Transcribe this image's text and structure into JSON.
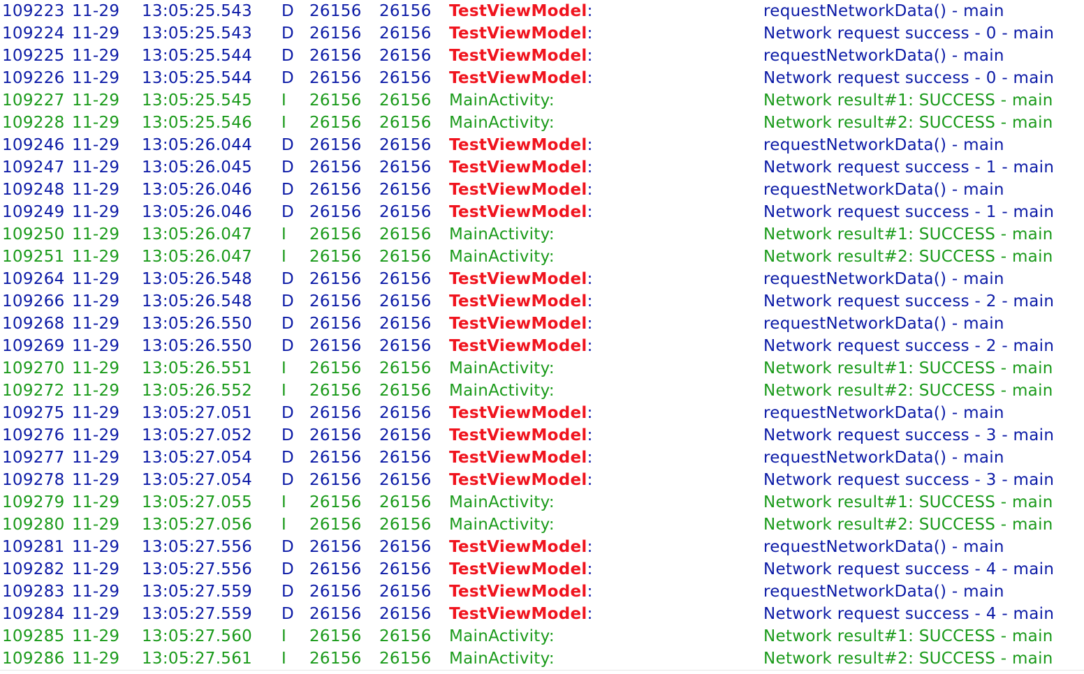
{
  "colors": {
    "debug_text": "#0b1aa6",
    "info_text": "#1a9a1a",
    "highlight_tag": "#f0141e",
    "background": "#ffffff"
  },
  "log_entries": [
    {
      "id": "109223",
      "date": "11-29",
      "time": "13:05:25.543",
      "level": "D",
      "pid": "26156",
      "tid": "26156",
      "tag": "TestViewModel",
      "sep": ":",
      "message": "requestNetworkData() - main"
    },
    {
      "id": "109224",
      "date": "11-29",
      "time": "13:05:25.543",
      "level": "D",
      "pid": "26156",
      "tid": "26156",
      "tag": "TestViewModel",
      "sep": ":",
      "message": "Network request success - 0 - main"
    },
    {
      "id": "109225",
      "date": "11-29",
      "time": "13:05:25.544",
      "level": "D",
      "pid": "26156",
      "tid": "26156",
      "tag": "TestViewModel",
      "sep": ":",
      "message": "requestNetworkData() - main"
    },
    {
      "id": "109226",
      "date": "11-29",
      "time": "13:05:25.544",
      "level": "D",
      "pid": "26156",
      "tid": "26156",
      "tag": "TestViewModel",
      "sep": ":",
      "message": "Network request success - 0 - main"
    },
    {
      "id": "109227",
      "date": "11-29",
      "time": "13:05:25.545",
      "level": "I",
      "pid": "26156",
      "tid": "26156",
      "tag": "MainActivity",
      "sep": ":",
      "message": "Network result#1: SUCCESS - main"
    },
    {
      "id": "109228",
      "date": "11-29",
      "time": "13:05:25.546",
      "level": "I",
      "pid": "26156",
      "tid": "26156",
      "tag": "MainActivity",
      "sep": ":",
      "message": "Network result#2: SUCCESS - main"
    },
    {
      "id": "109246",
      "date": "11-29",
      "time": "13:05:26.044",
      "level": "D",
      "pid": "26156",
      "tid": "26156",
      "tag": "TestViewModel",
      "sep": ":",
      "message": "requestNetworkData() - main"
    },
    {
      "id": "109247",
      "date": "11-29",
      "time": "13:05:26.045",
      "level": "D",
      "pid": "26156",
      "tid": "26156",
      "tag": "TestViewModel",
      "sep": ":",
      "message": "Network request success - 1 - main"
    },
    {
      "id": "109248",
      "date": "11-29",
      "time": "13:05:26.046",
      "level": "D",
      "pid": "26156",
      "tid": "26156",
      "tag": "TestViewModel",
      "sep": ":",
      "message": "requestNetworkData() - main"
    },
    {
      "id": "109249",
      "date": "11-29",
      "time": "13:05:26.046",
      "level": "D",
      "pid": "26156",
      "tid": "26156",
      "tag": "TestViewModel",
      "sep": ":",
      "message": "Network request success - 1 - main"
    },
    {
      "id": "109250",
      "date": "11-29",
      "time": "13:05:26.047",
      "level": "I",
      "pid": "26156",
      "tid": "26156",
      "tag": "MainActivity",
      "sep": ":",
      "message": "Network result#1: SUCCESS - main"
    },
    {
      "id": "109251",
      "date": "11-29",
      "time": "13:05:26.047",
      "level": "I",
      "pid": "26156",
      "tid": "26156",
      "tag": "MainActivity",
      "sep": ":",
      "message": "Network result#2: SUCCESS - main"
    },
    {
      "id": "109264",
      "date": "11-29",
      "time": "13:05:26.548",
      "level": "D",
      "pid": "26156",
      "tid": "26156",
      "tag": "TestViewModel",
      "sep": ":",
      "message": "requestNetworkData() - main"
    },
    {
      "id": "109266",
      "date": "11-29",
      "time": "13:05:26.548",
      "level": "D",
      "pid": "26156",
      "tid": "26156",
      "tag": "TestViewModel",
      "sep": ":",
      "message": "Network request success - 2 - main"
    },
    {
      "id": "109268",
      "date": "11-29",
      "time": "13:05:26.550",
      "level": "D",
      "pid": "26156",
      "tid": "26156",
      "tag": "TestViewModel",
      "sep": ":",
      "message": "requestNetworkData() - main"
    },
    {
      "id": "109269",
      "date": "11-29",
      "time": "13:05:26.550",
      "level": "D",
      "pid": "26156",
      "tid": "26156",
      "tag": "TestViewModel",
      "sep": ":",
      "message": "Network request success - 2 - main"
    },
    {
      "id": "109270",
      "date": "11-29",
      "time": "13:05:26.551",
      "level": "I",
      "pid": "26156",
      "tid": "26156",
      "tag": "MainActivity",
      "sep": ":",
      "message": "Network result#1: SUCCESS - main"
    },
    {
      "id": "109272",
      "date": "11-29",
      "time": "13:05:26.552",
      "level": "I",
      "pid": "26156",
      "tid": "26156",
      "tag": "MainActivity",
      "sep": ":",
      "message": "Network result#2: SUCCESS - main"
    },
    {
      "id": "109275",
      "date": "11-29",
      "time": "13:05:27.051",
      "level": "D",
      "pid": "26156",
      "tid": "26156",
      "tag": "TestViewModel",
      "sep": ":",
      "message": "requestNetworkData() - main"
    },
    {
      "id": "109276",
      "date": "11-29",
      "time": "13:05:27.052",
      "level": "D",
      "pid": "26156",
      "tid": "26156",
      "tag": "TestViewModel",
      "sep": ":",
      "message": "Network request success - 3 - main"
    },
    {
      "id": "109277",
      "date": "11-29",
      "time": "13:05:27.054",
      "level": "D",
      "pid": "26156",
      "tid": "26156",
      "tag": "TestViewModel",
      "sep": ":",
      "message": "requestNetworkData() - main"
    },
    {
      "id": "109278",
      "date": "11-29",
      "time": "13:05:27.054",
      "level": "D",
      "pid": "26156",
      "tid": "26156",
      "tag": "TestViewModel",
      "sep": ":",
      "message": "Network request success - 3 - main"
    },
    {
      "id": "109279",
      "date": "11-29",
      "time": "13:05:27.055",
      "level": "I",
      "pid": "26156",
      "tid": "26156",
      "tag": "MainActivity",
      "sep": ":",
      "message": "Network result#1: SUCCESS - main"
    },
    {
      "id": "109280",
      "date": "11-29",
      "time": "13:05:27.056",
      "level": "I",
      "pid": "26156",
      "tid": "26156",
      "tag": "MainActivity",
      "sep": ":",
      "message": "Network result#2: SUCCESS - main"
    },
    {
      "id": "109281",
      "date": "11-29",
      "time": "13:05:27.556",
      "level": "D",
      "pid": "26156",
      "tid": "26156",
      "tag": "TestViewModel",
      "sep": ":",
      "message": "requestNetworkData() - main"
    },
    {
      "id": "109282",
      "date": "11-29",
      "time": "13:05:27.556",
      "level": "D",
      "pid": "26156",
      "tid": "26156",
      "tag": "TestViewModel",
      "sep": ":",
      "message": "Network request success - 4 - main"
    },
    {
      "id": "109283",
      "date": "11-29",
      "time": "13:05:27.559",
      "level": "D",
      "pid": "26156",
      "tid": "26156",
      "tag": "TestViewModel",
      "sep": ":",
      "message": "requestNetworkData() - main"
    },
    {
      "id": "109284",
      "date": "11-29",
      "time": "13:05:27.559",
      "level": "D",
      "pid": "26156",
      "tid": "26156",
      "tag": "TestViewModel",
      "sep": ":",
      "message": "Network request success - 4 - main"
    },
    {
      "id": "109285",
      "date": "11-29",
      "time": "13:05:27.560",
      "level": "I",
      "pid": "26156",
      "tid": "26156",
      "tag": "MainActivity",
      "sep": ":",
      "message": "Network result#1: SUCCESS - main"
    },
    {
      "id": "109286",
      "date": "11-29",
      "time": "13:05:27.561",
      "level": "I",
      "pid": "26156",
      "tid": "26156",
      "tag": "MainActivity",
      "sep": ":",
      "message": "Network result#2: SUCCESS - main"
    }
  ]
}
